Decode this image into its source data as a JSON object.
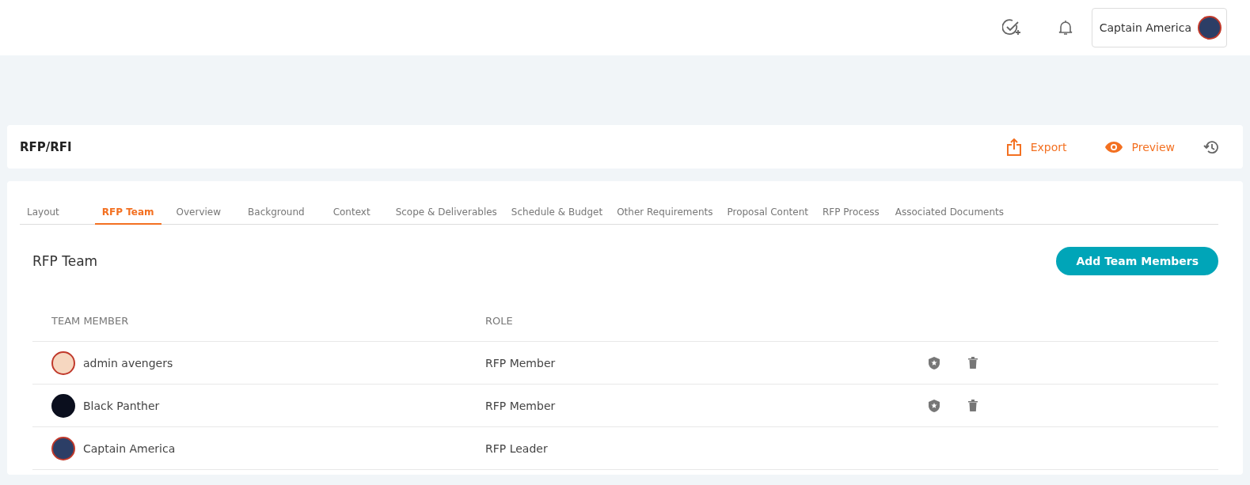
{
  "header": {
    "user": {
      "name": "Captain America"
    }
  },
  "page": {
    "title": "RFP/RFI",
    "actions": [
      {
        "kind": "export",
        "label": "Export"
      },
      {
        "kind": "preview",
        "label": "Preview"
      },
      {
        "kind": "history"
      }
    ]
  },
  "tabs": [
    {
      "label": "Layout",
      "selected": false
    },
    {
      "label": "RFP Team",
      "selected": true
    },
    {
      "label": "Overview",
      "selected": false
    },
    {
      "label": "Background",
      "selected": false
    },
    {
      "label": "Context",
      "selected": false
    },
    {
      "label": "Scope & Deliverables",
      "selected": false
    },
    {
      "label": "Schedule & Budget",
      "selected": false
    },
    {
      "label": "Other Requirements",
      "selected": false
    },
    {
      "label": "Proposal Content",
      "selected": false
    },
    {
      "label": "RFP Process",
      "selected": false
    },
    {
      "label": "Associated Documents",
      "selected": false
    }
  ],
  "section": {
    "title": "RFP Team",
    "button": "Add Team Members"
  },
  "table": {
    "columns": [
      "TEAM MEMBER",
      "ROLE"
    ],
    "rows": [
      {
        "name": "admin avengers",
        "role": "RFP Member",
        "removable": true
      },
      {
        "name": "Black Panther",
        "role": "RFP Member",
        "removable": true
      },
      {
        "name": "Captain America",
        "role": "RFP Leader",
        "removable": false
      }
    ]
  }
}
